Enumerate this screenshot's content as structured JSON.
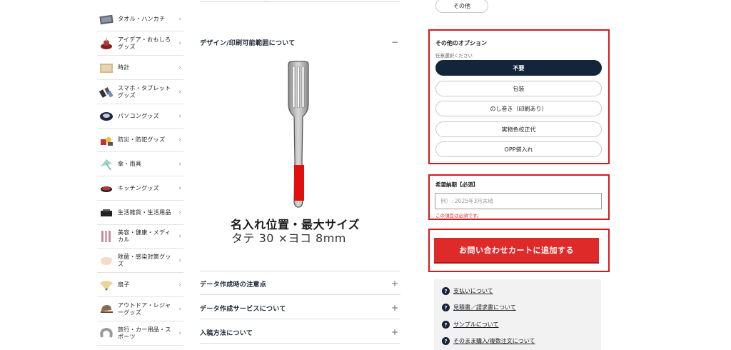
{
  "sidebar": {
    "items": [
      {
        "label": "タオル・ハンカチ",
        "icon": "towel-icon"
      },
      {
        "label": "アイデア・おもしろグッズ",
        "icon": "idea-goods-icon"
      },
      {
        "label": "時計",
        "icon": "clock-icon"
      },
      {
        "label": "スマホ・タブレットグッズ",
        "icon": "smartphone-icon"
      },
      {
        "label": "パソコングッズ",
        "icon": "mouse-icon"
      },
      {
        "label": "防災・防犯グッズ",
        "icon": "disaster-kit-icon"
      },
      {
        "label": "傘・雨具",
        "icon": "umbrella-icon"
      },
      {
        "label": "キッチングッズ",
        "icon": "pan-icon"
      },
      {
        "label": "生活雑貨・生活用品",
        "icon": "household-icon"
      },
      {
        "label": "美容・健康・メディカル",
        "icon": "beauty-icon"
      },
      {
        "label": "除菌・感染対策グッズ",
        "icon": "mask-icon"
      },
      {
        "label": "扇子",
        "icon": "fan-icon"
      },
      {
        "label": "アウトドア・レジャーグッズ",
        "icon": "cap-icon"
      },
      {
        "label": "旅行・カー用品・スポーツ",
        "icon": "neck-pillow-icon"
      }
    ]
  },
  "main": {
    "design_section": {
      "title": "デザイン/印刷可能範囲について",
      "sign": "−"
    },
    "print_position": {
      "title": "名入れ位置・最大サイズ",
      "size": "タテ 30 ×ヨコ 8mm"
    },
    "accordions": [
      {
        "title": "データ作成時の注意点",
        "sign": "+"
      },
      {
        "title": "データ作成サービスについて",
        "sign": "+"
      },
      {
        "title": "入稿方法について",
        "sign": "+"
      }
    ]
  },
  "options": {
    "prev_pill": "その他",
    "title": "その他のオプション",
    "subtitle": "任意選択ください",
    "choices": [
      {
        "label": "不要",
        "selected": true
      },
      {
        "label": "包装",
        "selected": false
      },
      {
        "label": "のし巻き（印刷あり）",
        "selected": false
      },
      {
        "label": "実物色校正代",
        "selected": false
      },
      {
        "label": "OPP袋入れ",
        "selected": false
      }
    ]
  },
  "delivery": {
    "label": "希望納期【必須】",
    "placeholder": "例）: 2025年3月末頃",
    "error": "この項目は必須です。"
  },
  "cart_button": "お問い合わせカートに追加する",
  "info_links": [
    "支払いについて",
    "見積書／請求書について",
    "サンプルについて",
    "そのまま購入/複数注文について"
  ],
  "colors": {
    "accent_red": "#d7191f",
    "button_red": "#df2a2a",
    "navy": "#12253b"
  }
}
